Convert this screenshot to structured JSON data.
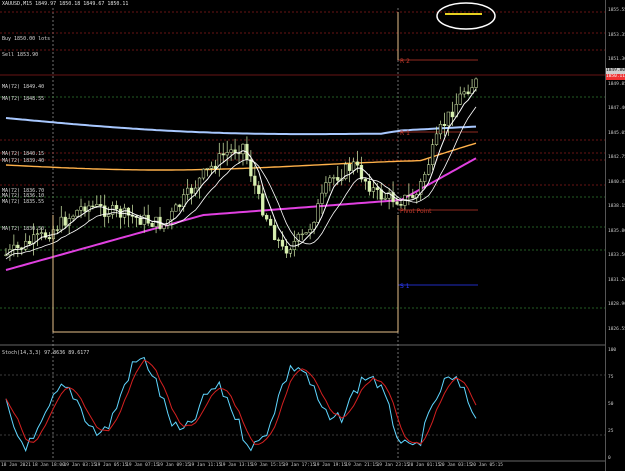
{
  "window": {
    "title": "XAUUSD,M15",
    "ohlc": "1849.97 1850.18 1849.67 1850.11"
  },
  "chart_data": [
    {
      "type": "candlestick",
      "symbol": "XAUUSD",
      "timeframe": "M15",
      "price_axis": {
        "ticks": [
          "1855.55",
          "1853.35",
          "1851.30",
          "1849.85",
          "1847.40",
          "1845.05",
          "1842.75",
          "1840.45",
          "1838.15",
          "1835.80",
          "1833.50",
          "1831.20",
          "1828.90",
          "1826.55"
        ],
        "current_price": "1850.11",
        "previous_tag": "1849.80"
      },
      "time_axis": {
        "ticks": [
          "18 Jan 2021",
          "18 Jan 18:00",
          "19 Jan 03:15",
          "19 Jan 05:15",
          "19 Jan 07:15",
          "19 Jan 09:15",
          "19 Jan 11:15",
          "19 Jan 13:15",
          "19 Jan 15:15",
          "19 Jan 17:15",
          "19 Jan 19:15",
          "19 Jan 21:15",
          "19 Jan 23:15",
          "20 Jan 01:15",
          "20 Jan 03:15",
          "20 Jan 05:15"
        ]
      },
      "pivot_levels": [
        {
          "name": "R 2",
          "color": "#c0392b"
        },
        {
          "name": "R 1",
          "color": "#c0392b"
        },
        {
          "name": "Pivot Point",
          "color": "#c0392b"
        },
        {
          "name": "S 1",
          "color": "#2d3bff"
        }
      ],
      "left_labels": [
        "Buy 1850.00 lots",
        "Sell 1853.90",
        "MA(72) 1849.40",
        "MA(72) 1848.55",
        "MA(72) 1840.15",
        "MA(72) 1839.40",
        "MA(72) 1836.70",
        "MA(72) 1836.10",
        "MA(72) 1835.55",
        "MA(72) 1830.50"
      ],
      "colors": {
        "candle": "#d8f0b0",
        "ma_fast": "#ffffff",
        "ma_slow": "#ffb14a",
        "ma_trend": "#e040e0",
        "ma_long": "#a8c8ff",
        "level_red": "#8b1a1a",
        "level_green": "#2f7a2f",
        "level_blue": "#2d3bff",
        "highlight_circle": "#ffffff"
      }
    },
    {
      "type": "line",
      "title": "Stoch(14,3,3) 97.8636 89.6177",
      "y_ticks": [
        "100",
        "75",
        "50",
        "25",
        "0"
      ],
      "series": [
        {
          "name": "%K",
          "color": "#5fd6ff"
        },
        {
          "name": "%D",
          "color": "#d42020"
        }
      ]
    }
  ]
}
